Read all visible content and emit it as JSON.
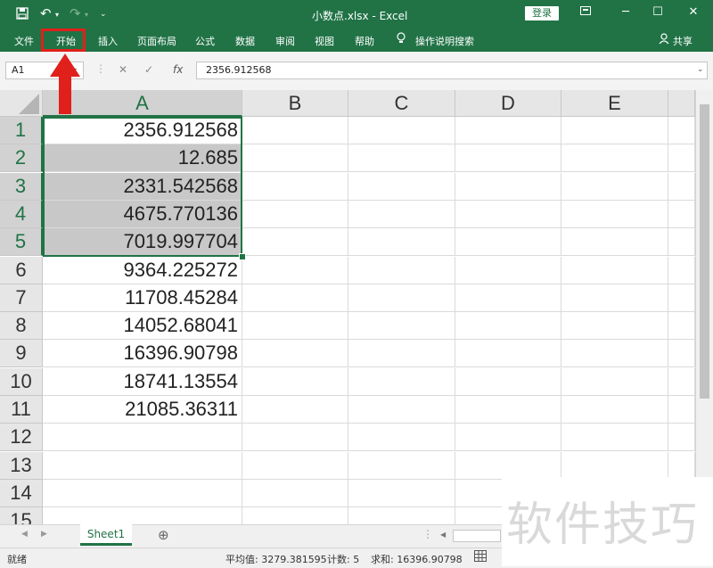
{
  "titlebar": {
    "title": "小数点.xlsx  -  Excel",
    "login": "登录",
    "save_icon": "save-icon",
    "undo_icon": "undo-icon",
    "redo_icon": "redo-icon"
  },
  "ribbon": {
    "tabs": [
      "文件",
      "开始",
      "插入",
      "页面布局",
      "公式",
      "数据",
      "审阅",
      "视图",
      "帮助"
    ],
    "search": "操作说明搜索",
    "share": "共享"
  },
  "formula_bar": {
    "name_box": "A1",
    "fx": "fx",
    "content": "2356.912568"
  },
  "columns": [
    "A",
    "B",
    "C",
    "D",
    "E"
  ],
  "rows": [
    "1",
    "2",
    "3",
    "4",
    "5",
    "6",
    "7",
    "8",
    "9",
    "10",
    "11",
    "12",
    "13",
    "14",
    "15"
  ],
  "column_a": [
    "2356.912568",
    "12.685",
    "2331.542568",
    "4675.770136",
    "7019.997704",
    "9364.225272",
    "11708.45284",
    "14052.68041",
    "16396.90798",
    "18741.13554",
    "21085.36311",
    "",
    "",
    "",
    ""
  ],
  "sheet": {
    "tab": "Sheet1",
    "add": "⊕"
  },
  "status": {
    "ready": "就绪",
    "average": "平均值: 3279.381595",
    "count": "计数: 5",
    "sum": "求和: 16396.90798"
  },
  "watermark": "软件技巧",
  "colors": {
    "accent": "#217346",
    "highlight": "#e0201a"
  }
}
